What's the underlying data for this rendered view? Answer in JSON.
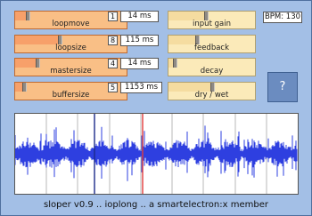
{
  "left_sliders": [
    {
      "label": "loopmove",
      "index": "1",
      "value": "14 ms",
      "level": 0.1
    },
    {
      "label": "loopsize",
      "index": "8",
      "value": "115 ms",
      "level": 0.4
    },
    {
      "label": "mastersize",
      "index": "4",
      "value": "14 ms",
      "level": 0.19
    },
    {
      "label": "buffersize",
      "index": "5",
      "value": "1153 ms",
      "level": 0.07
    }
  ],
  "right_sliders": [
    {
      "label": "input gain",
      "level": 0.43
    },
    {
      "label": "feedback",
      "level": 0.33
    },
    {
      "label": "decay",
      "level": 0.05
    },
    {
      "label": "dry / wet",
      "level": 0.51
    }
  ],
  "bpm": "BPM: 130",
  "help": "?",
  "footer": "sloper v0.9 .. ioplong .. a smartelectron:x member",
  "waveform": {
    "loop_start": 0.28,
    "loop_end": 0.45,
    "markers": 8
  }
}
